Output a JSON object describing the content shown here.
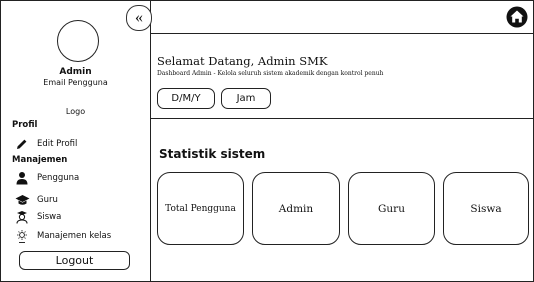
{
  "sidebar": {
    "collapse_icon": "double-chevron-left-icon",
    "collapse_glyph": "«",
    "user_name": "Admin",
    "user_email": "Email Pengguna",
    "logo_label": "Logo",
    "section_profile": "Profil",
    "edit_profile": "Edit Profil",
    "section_management": "Manajemen",
    "items": [
      {
        "label": "Pengguna",
        "icon": "user-icon"
      },
      {
        "label": "Guru",
        "icon": "graduation-cap-icon"
      },
      {
        "label": "Siswa",
        "icon": "student-icon"
      },
      {
        "label": "Manajemen kelas",
        "icon": "class-management-icon"
      }
    ],
    "logout": "Logout"
  },
  "topbar": {
    "home_icon": "home-icon"
  },
  "header": {
    "title": "Selamat Datang, Admin SMK",
    "subtitle": "Dashboard Admin - Kelola seluruh sistem akademik dengan kontrol penuh",
    "date": "D/M/Y",
    "time": "Jam"
  },
  "stats": {
    "title": "Statistik sistem",
    "cards": [
      {
        "label": "Total Pengguna"
      },
      {
        "label": "Admin"
      },
      {
        "label": "Guru"
      },
      {
        "label": "Siswa"
      }
    ]
  }
}
